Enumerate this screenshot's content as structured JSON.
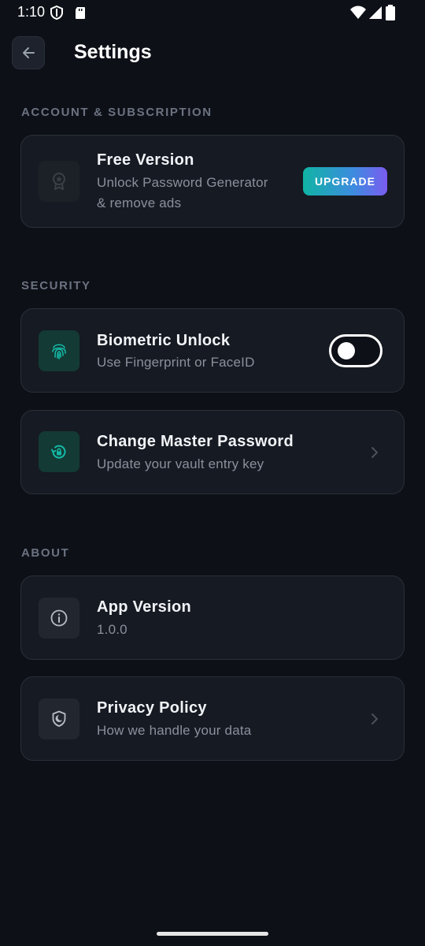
{
  "status_bar": {
    "time": "1:10",
    "icons": [
      "shield-status-icon",
      "sd-card-icon",
      "wifi-icon",
      "signal-icon",
      "battery-icon"
    ]
  },
  "header": {
    "title": "Settings",
    "back_icon": "arrow-left-icon"
  },
  "sections": {
    "account": {
      "label": "ACCOUNT & SUBSCRIPTION",
      "free_version": {
        "icon": "award-icon",
        "title": "Free Version",
        "subtitle_line1": "Unlock Password Generator",
        "subtitle_line2": "& remove ads",
        "button_label": "UPGRADE"
      }
    },
    "security": {
      "label": "SECURITY",
      "biometric": {
        "icon": "fingerprint-icon",
        "title": "Biometric Unlock",
        "subtitle": "Use Fingerprint or FaceID",
        "enabled": false
      },
      "change_password": {
        "icon": "lock-reset-icon",
        "title": "Change Master Password",
        "subtitle": "Update your vault entry key"
      }
    },
    "about": {
      "label": "ABOUT",
      "app_version": {
        "icon": "info-icon",
        "title": "App Version",
        "subtitle": "1.0.0"
      },
      "privacy": {
        "icon": "shield-icon",
        "title": "Privacy Policy",
        "subtitle": "How we handle your data"
      }
    }
  },
  "colors": {
    "background": "#0d1017",
    "card": "#161a22",
    "accent_teal": "#14b8a6",
    "accent_purple": "#7b5cf0",
    "muted_text": "#8a909c"
  }
}
